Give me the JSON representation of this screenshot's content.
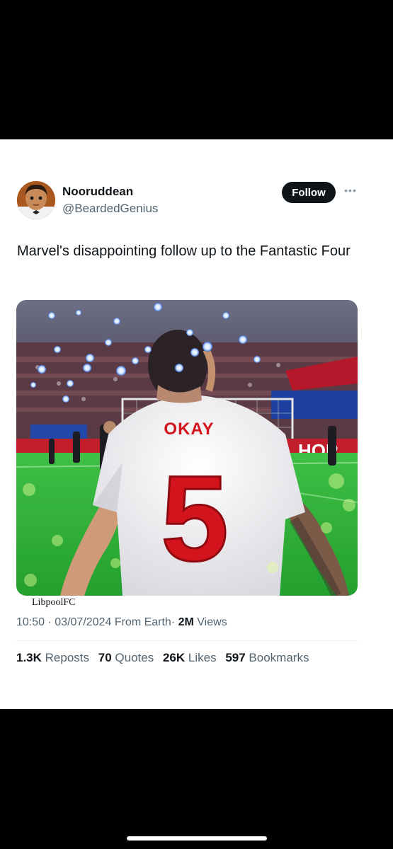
{
  "tweet": {
    "author_name": "Nooruddean",
    "author_handle": "@BeardedGenius",
    "follow_label": "Follow",
    "more_icon": "more-dots-icon",
    "text": "Marvel's disappointing follow up to the Fantastic Four",
    "media": {
      "jersey_name": "OKAY",
      "jersey_number": "5",
      "hoarding_text": "HOP"
    },
    "media_caption": "LibpoolFC",
    "time": "10:50",
    "date": "03/07/2024",
    "source": "From Earth",
    "views_count": "2M",
    "views_label": "Views",
    "separator": "·",
    "stats": [
      {
        "count": "1.3K",
        "label": "Reposts"
      },
      {
        "count": "70",
        "label": "Quotes"
      },
      {
        "count": "26K",
        "label": "Likes"
      },
      {
        "count": "597",
        "label": "Bookmarks"
      }
    ]
  },
  "colors": {
    "text_primary": "#0f1419",
    "text_secondary": "#536471",
    "follow_bg": "#0f1419",
    "pitch_green": "#2fae3a",
    "jersey_red": "#d4141c"
  }
}
